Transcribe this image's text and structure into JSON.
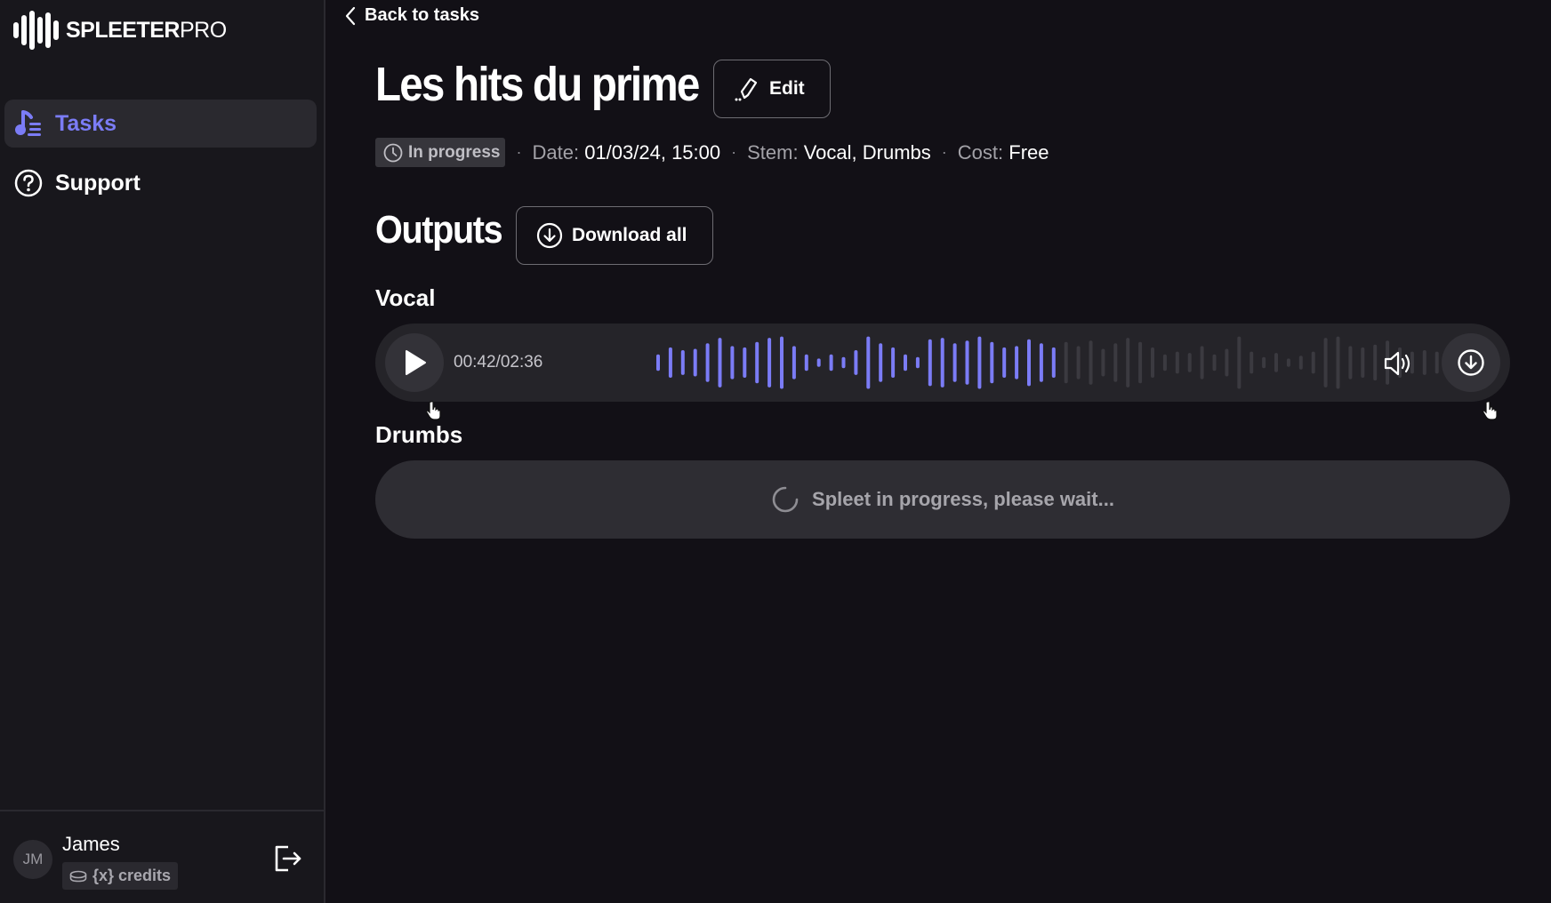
{
  "app": {
    "brand_bold": "SPLEETER",
    "brand_light": "PRO"
  },
  "sidebar": {
    "items": [
      {
        "label": "Tasks",
        "icon": "music-note-list-icon",
        "active": true
      },
      {
        "label": "Support",
        "icon": "question-circle-icon",
        "active": false
      }
    ],
    "user": {
      "initials": "JM",
      "name": "James",
      "credits": "{x} credits"
    }
  },
  "header": {
    "back_label": "Back to tasks",
    "title": "Les hits du prime",
    "edit_label": "Edit"
  },
  "meta": {
    "status": "In progress",
    "separator": "·",
    "date_label": "Date:",
    "date_value": "01/03/24, 15:00",
    "stem_label": "Stem:",
    "stem_value": "Vocal, Drumbs",
    "cost_label": "Cost:",
    "cost_value": "Free"
  },
  "outputs": {
    "title": "Outputs",
    "download_all_label": "Download all",
    "tracks": [
      {
        "name": "Vocal",
        "time": "00:42/02:36",
        "played_fraction": 0.5,
        "waveform": [
          0.3,
          0.55,
          0.45,
          0.5,
          0.7,
          0.9,
          0.6,
          0.55,
          0.75,
          0.9,
          0.95,
          0.6,
          0.3,
          0.15,
          0.3,
          0.2,
          0.45,
          0.95,
          0.7,
          0.55,
          0.3,
          0.2,
          0.85,
          0.9,
          0.7,
          0.8,
          0.95,
          0.75,
          0.55,
          0.6,
          0.85,
          0.7,
          0.55,
          0.75,
          0.6,
          0.8,
          0.5,
          0.7,
          0.9,
          0.75,
          0.55,
          0.3,
          0.4,
          0.35,
          0.6,
          0.3,
          0.5,
          0.95,
          0.4,
          0.2,
          0.35,
          0.15,
          0.25,
          0.4,
          0.9,
          0.95,
          0.6,
          0.55,
          0.65,
          0.8,
          0.55,
          0.4,
          0.45,
          0.4,
          0.3
        ],
        "accent": "#7b7cf6",
        "unplayed": "#3b3a40"
      },
      {
        "name": "Drumbs",
        "progress_text": "Spleet in progress, please wait..."
      }
    ]
  }
}
